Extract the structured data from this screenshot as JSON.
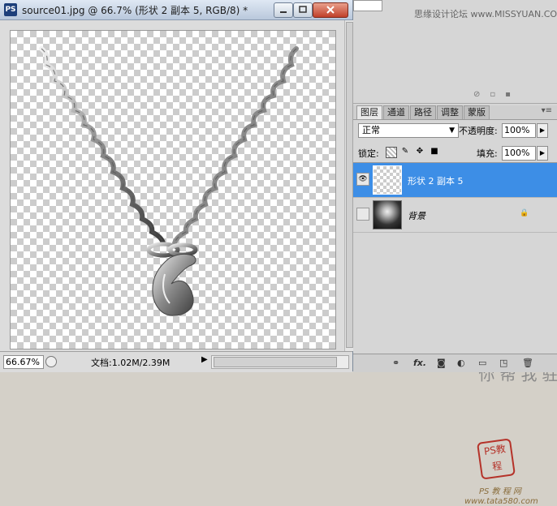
{
  "document": {
    "app_icon": "PS",
    "title": "source01.jpg @ 66.7% (形状 2 副本 5, RGB/8) *",
    "window_buttons": [
      "minimize-icon",
      "maximize-icon",
      "close-icon"
    ]
  },
  "status": {
    "zoom": "66.67%",
    "doc_info": "文档:1.02M/2.39M",
    "arrow": "▶"
  },
  "top_panel": {
    "watermark": "思缘设计论坛 www.MISSYUAN.COM",
    "icons": [
      "visibility-off-icon",
      "new-icon",
      "trash-icon"
    ]
  },
  "panels": {
    "tabs": [
      "图层",
      "通道",
      "路径",
      "调整",
      "蒙版"
    ],
    "menu_glyph": "▾≡"
  },
  "layer_controls": {
    "blend_mode": "正常",
    "opacity_label": "不透明度:",
    "opacity_value": "100%",
    "lock_label": "锁定:",
    "fill_label": "填充:",
    "fill_value": "100%",
    "lock_icons": [
      "lock-transparency-icon",
      "lock-paint-icon",
      "lock-move-icon",
      "lock-all-icon"
    ]
  },
  "layers": [
    {
      "name": "形状 2 副本 5",
      "visible": true,
      "selected": true
    },
    {
      "name": "背景",
      "visible": false,
      "selected": false,
      "locked": true
    }
  ],
  "watermark_art": {
    "calligraphy": "他驻我帮你",
    "seal": "PS教程",
    "site": "PS 教 程 网",
    "url": "www.tata580.com"
  },
  "footer_icons": [
    "link-icon",
    "fx-icon",
    "mask-icon",
    "adjustment-icon",
    "group-icon",
    "new-layer-icon",
    "trash-icon"
  ],
  "colors": {
    "selection": "#3d8ee6",
    "chrome": "#d6d6d6"
  }
}
